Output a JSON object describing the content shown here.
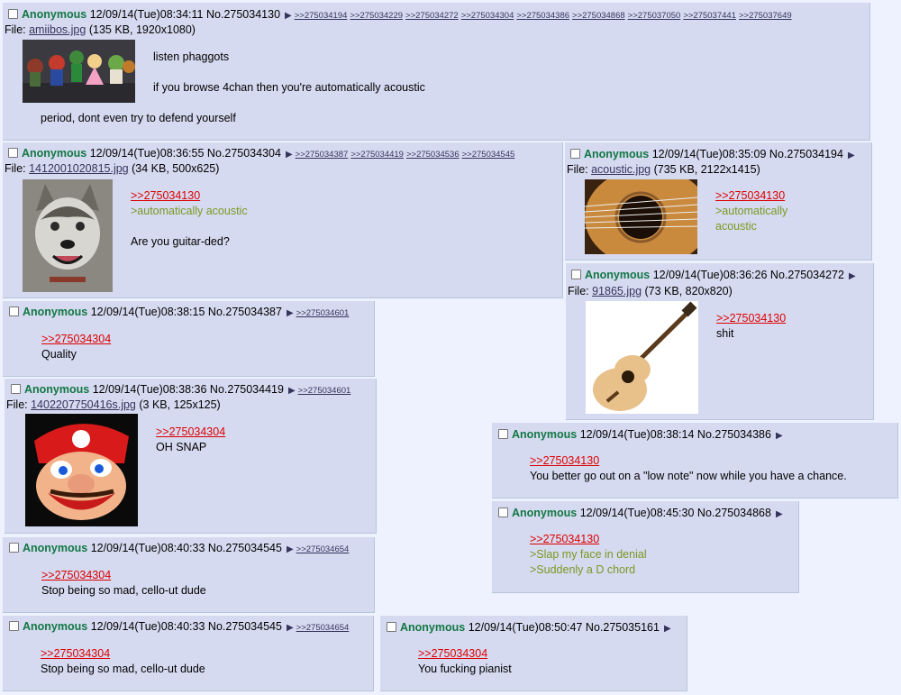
{
  "colors": {
    "background": "#eef2ff",
    "post_bg": "#d6daf0",
    "name": "#117743",
    "quotelink": "#dd0000",
    "greentext": "#789922",
    "link": "#34345c"
  },
  "posts": {
    "p130": {
      "name": "Anonymous",
      "datetime": "12/09/14(Tue)08:34:11",
      "number": "No.275034130",
      "backlinks": [
        ">>275034194",
        ">>275034229",
        ">>275034272",
        ">>275034304",
        ">>275034386",
        ">>275034868",
        ">>275037050",
        ">>275037441",
        ">>275037649"
      ],
      "file_prefix": "File:",
      "file_name": "amiibos.jpg",
      "file_meta": "(135 KB, 1920x1080)",
      "lines": [
        "listen phaggots",
        "if you browse 4chan then you're automatically acoustic",
        "period, dont even try to defend yourself"
      ]
    },
    "p304": {
      "name": "Anonymous",
      "datetime": "12/09/14(Tue)08:36:55",
      "number": "No.275034304",
      "backlinks": [
        ">>275034387",
        ">>275034419",
        ">>275034536",
        ">>275034545"
      ],
      "file_prefix": "File:",
      "file_name": "1412001020815.jpg",
      "file_meta": "(34 KB, 500x625)",
      "quote": ">>275034130",
      "green": ">automatically acoustic",
      "text": "Are you guitar-ded?"
    },
    "p194": {
      "name": "Anonymous",
      "datetime": "12/09/14(Tue)08:35:09",
      "number": "No.275034194",
      "file_prefix": "File:",
      "file_name": "acoustic.jpg",
      "file_meta": "(735 KB, 2122x1415)",
      "quote": ">>275034130",
      "green1": ">automatically",
      "green2": "acoustic"
    },
    "p272": {
      "name": "Anonymous",
      "datetime": "12/09/14(Tue)08:36:26",
      "number": "No.275034272",
      "file_prefix": "File:",
      "file_name": "91865.jpg",
      "file_meta": "(73 KB, 820x820)",
      "quote": ">>275034130",
      "text": "shit"
    },
    "p387": {
      "name": "Anonymous",
      "datetime": "12/09/14(Tue)08:38:15",
      "number": "No.275034387",
      "backlinks": [
        ">>275034601"
      ],
      "quote": ">>275034304",
      "text": "Quality"
    },
    "p419": {
      "name": "Anonymous",
      "datetime": "12/09/14(Tue)08:38:36",
      "number": "No.275034419",
      "backlinks": [
        ">>275034601"
      ],
      "file_prefix": "File:",
      "file_name": "1402207750416s.jpg",
      "file_meta": "(3 KB, 125x125)",
      "quote": ">>275034304",
      "text": "OH SNAP"
    },
    "p386": {
      "name": "Anonymous",
      "datetime": "12/09/14(Tue)08:38:14",
      "number": "No.275034386",
      "quote": ">>275034130",
      "text": "You better go out on a \"low note\" now while you have a chance."
    },
    "p868": {
      "name": "Anonymous",
      "datetime": "12/09/14(Tue)08:45:30",
      "number": "No.275034868",
      "quote": ">>275034130",
      "green1": ">Slap my face in denial",
      "green2": ">Suddenly a D chord"
    },
    "p545a": {
      "name": "Anonymous",
      "datetime": "12/09/14(Tue)08:40:33",
      "number": "No.275034545",
      "backlinks": [
        ">>275034654"
      ],
      "quote": ">>275034304",
      "text": "Stop being so mad, cello-ut dude"
    },
    "p545b": {
      "name": "Anonymous",
      "datetime": "12/09/14(Tue)08:40:33",
      "number": "No.275034545",
      "backlinks": [
        ">>275034654"
      ],
      "quote": ">>275034304",
      "text": "Stop being so mad, cello-ut dude"
    },
    "p161": {
      "name": "Anonymous",
      "datetime": "12/09/14(Tue)08:50:47",
      "number": "No.275035161",
      "quote": ">>275034304",
      "text": "You fucking pianist"
    }
  }
}
